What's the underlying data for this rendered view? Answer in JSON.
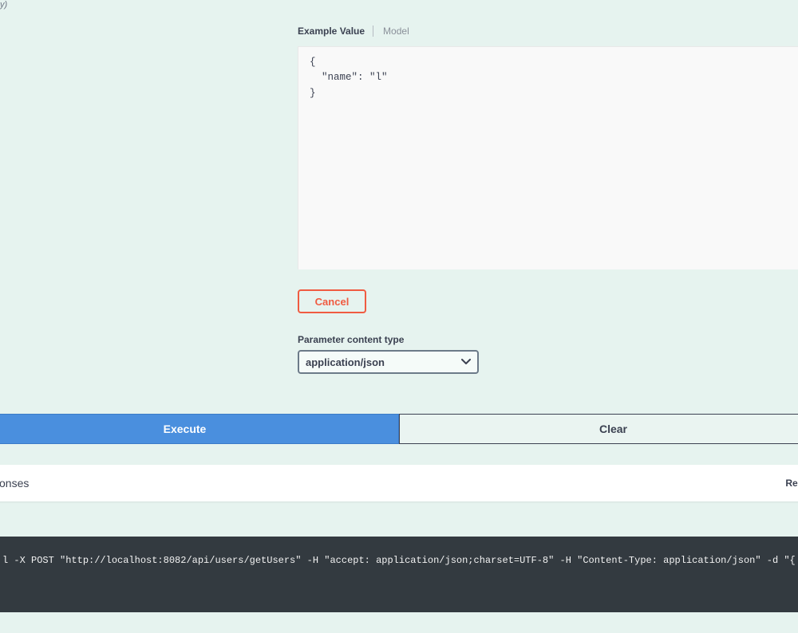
{
  "left": {
    "line1": "y)",
    "line2": ""
  },
  "body": {
    "truncated_top": "",
    "tabs": {
      "active": "Example Value",
      "inactive": "Model"
    },
    "textarea_value": "{\n  \"name\": \"l\"\n}",
    "cancel_label": "Cancel",
    "param_type_label": "Parameter content type",
    "content_type_value": "application/json"
  },
  "buttons": {
    "execute": "Execute",
    "clear": "Clear"
  },
  "responses": {
    "left_label": "onses",
    "right_label": "Respo"
  },
  "curl": {
    "command": "l -X POST \"http://localhost:8082/api/users/getUsers\" -H \"accept: application/json;charset=UTF-8\" -H \"Content-Type: application/json\" -d \"{ "
  }
}
